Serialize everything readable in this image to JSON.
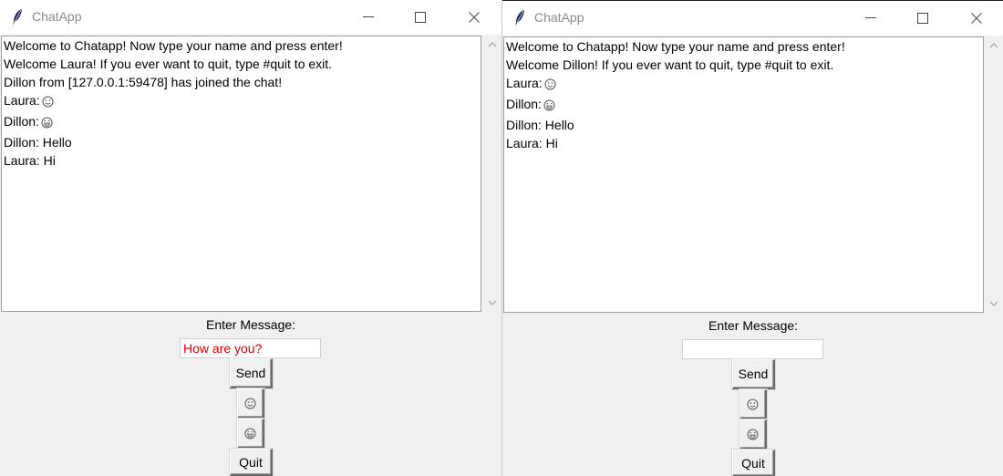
{
  "windows": [
    {
      "title": "ChatApp",
      "messages": [
        {
          "text": "Welcome to Chatapp! Now type your name and press enter!",
          "icon": null
        },
        {
          "text": "Welcome Laura! If you ever want to quit, type #quit to exit.",
          "icon": null
        },
        {
          "text": "Dillon from [127.0.0.1:59478] has joined the chat!",
          "icon": null
        },
        {
          "text": "Laura:",
          "icon": "smiley-face-icon"
        },
        {
          "text": "Dillon:",
          "icon": "laughing-face-icon"
        },
        {
          "text": "Dillon: Hello",
          "icon": null
        },
        {
          "text": "Laura: Hi",
          "icon": null
        }
      ],
      "enter_label": "Enter Message:",
      "input_value": "How are you?",
      "send_label": "Send",
      "quit_label": "Quit",
      "emoji_buttons": [
        "smiley-face-icon",
        "laughing-face-icon"
      ]
    },
    {
      "title": "ChatApp",
      "messages": [
        {
          "text": "Welcome to Chatapp! Now type your name and press enter!",
          "icon": null
        },
        {
          "text": "Welcome Dillon! If you ever want to quit, type #quit to exit.",
          "icon": null
        },
        {
          "text": "Laura:",
          "icon": "smiley-face-icon"
        },
        {
          "text": "Dillon:",
          "icon": "laughing-face-icon"
        },
        {
          "text": "Dillon: Hello",
          "icon": null
        },
        {
          "text": "Laura: Hi",
          "icon": null
        }
      ],
      "enter_label": "Enter Message:",
      "input_value": "",
      "send_label": "Send",
      "quit_label": "Quit",
      "emoji_buttons": [
        "smiley-face-icon",
        "laughing-face-icon"
      ]
    }
  ],
  "colors": {
    "input_text": "#e00000",
    "window_bg": "#f0f0f0",
    "title_text": "#8a8a8a"
  }
}
